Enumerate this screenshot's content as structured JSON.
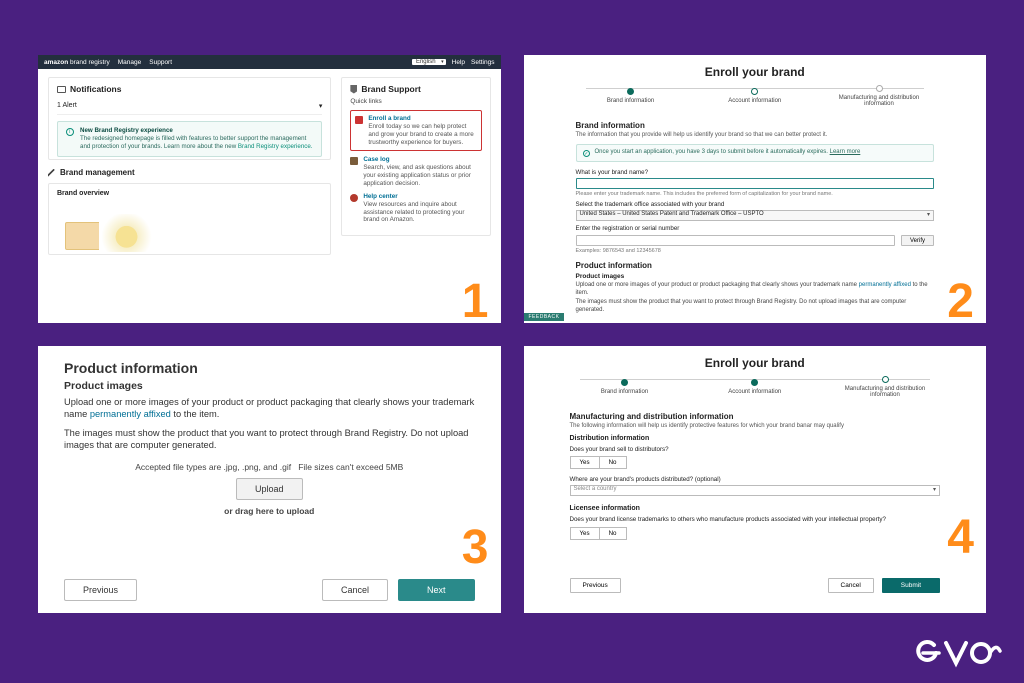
{
  "steps_numbers": [
    "1",
    "2",
    "3",
    "4"
  ],
  "panel1": {
    "topbar": {
      "brand_left": "amazon",
      "brand_right": "brand registry",
      "manage": "Manage",
      "support": "Support",
      "language": "English",
      "help": "Help",
      "settings": "Settings"
    },
    "notifications": {
      "heading": "Notifications",
      "alert_line": "1 Alert",
      "chevron": "▾"
    },
    "new_experience": {
      "title": "New Brand Registry experience",
      "body": "The redesigned homepage is filled with features to better support the management and protection of your brands. Learn more about the new ",
      "link": "Brand Registry experience."
    },
    "brand_management": {
      "heading": "Brand management",
      "overview": "Brand overview"
    },
    "brand_support": {
      "heading": "Brand Support",
      "quick_links_label": "Quick links",
      "items": [
        {
          "title": "Enroll a brand",
          "body": "Enroll today so we can help protect and grow your brand to create a more trustworthy experience for buyers."
        },
        {
          "title": "Case log",
          "body": "Search, view, and ask questions about your existing application status or prior application decision."
        },
        {
          "title": "Help center",
          "body": "View resources and inquire about assistance related to protecting your brand on Amazon."
        }
      ]
    }
  },
  "panel2": {
    "title": "Enroll your brand",
    "step_labels": [
      "Brand information",
      "Account information",
      "Manufacturing and distribution information"
    ],
    "brand_info_h": "Brand information",
    "brand_info_sub": "The information that you provide will help us identify your brand so that we can better protect it.",
    "tip": "Once you start an application, you have 3 days to submit before it automatically expires. ",
    "tip_link": "Learn more",
    "q_brand_name": "What is your brand name?",
    "brand_name_hint": "Please enter your trademark name. This includes the preferred form of capitalization for your brand name.",
    "q_trademark_office": "Select the trademark office associated with your brand",
    "trademark_office_value": "United States – United States Patent and Trademark Office – USPTO",
    "q_reg_serial": "Enter the registration or serial number",
    "verify": "Verify",
    "examples": "Examples: 9876543 and 12345678",
    "product_info_h": "Product information",
    "product_images_h": "Product images",
    "product_images_p1": "Upload one or more images of your product or product packaging that clearly shows your trademark name ",
    "product_images_link": "permanently affixed",
    "product_images_p1_tail": " to the item.",
    "product_images_p2": "The images must show the product that you want to protect through Brand Registry. Do not upload images that are computer generated.",
    "feedback": "FEEDBACK"
  },
  "panel3": {
    "h1": "Product information",
    "h2": "Product images",
    "p1_a": "Upload one or more images of your product or product packaging that clearly shows your trademark name ",
    "p1_link": "permanently affixed",
    "p1_b": " to the item.",
    "p2": "The images must show the product that you want to protect through Brand Registry. Do not upload images that are computer generated.",
    "accept_a": "Accepted file types are .jpg, .png, and .gif",
    "accept_b": "File sizes can't exceed 5MB",
    "upload": "Upload",
    "drag": "or drag here to upload",
    "previous": "Previous",
    "cancel": "Cancel",
    "next": "Next"
  },
  "panel4": {
    "title": "Enroll your brand",
    "step_labels": [
      "Brand information",
      "Account information",
      "Manufacturing and distribution information"
    ],
    "h": "Manufacturing and distribution information",
    "sub": "The following information will help us identify protective features for which your brand banar may qualify",
    "dist_h": "Distribution information",
    "q1": "Does your brand sell to distributors?",
    "yes": "Yes",
    "no": "No",
    "q2": "Where are your brand's products distributed? (optional)",
    "q2_placeholder": "Select a country",
    "lic_h": "Licensee information",
    "q3": "Does your brand license trademarks to others who manufacture products associated with your intellectual property?",
    "previous": "Previous",
    "cancel": "Cancel",
    "submit": "Submit"
  }
}
